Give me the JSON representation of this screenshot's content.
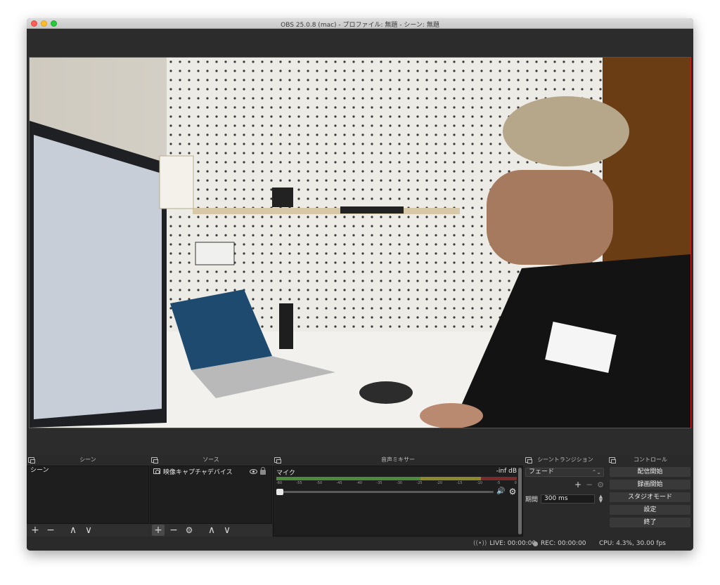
{
  "window": {
    "title": "OBS 25.0.8 (mac) - プロファイル: 無題 - シーン: 無題"
  },
  "docks": {
    "scenes": {
      "title": "シーン",
      "items": [
        "シーン"
      ],
      "toolbar": [
        "+",
        "−",
        "∧",
        "∨"
      ]
    },
    "sources": {
      "title": "ソース",
      "items": [
        {
          "label": "映像キャプチャデバイス",
          "icon": "camera-icon"
        }
      ],
      "toolbar": [
        "+",
        "−",
        "⚙",
        "∧",
        "∨"
      ]
    },
    "mixer": {
      "title": "音声ミキサー",
      "channel_name": "マイク",
      "level": "-inf dB",
      "volume_fraction": 0,
      "ticks": [
        "-60",
        "-55",
        "-50",
        "-45",
        "-40",
        "-35",
        "-30",
        "-25",
        "-20",
        "-15",
        "-10",
        "-5",
        "0"
      ]
    },
    "transitions": {
      "title": "シーントランジション",
      "selected": "フェード",
      "duration_label": "期間",
      "duration_value": "300 ms"
    },
    "controls": {
      "title": "コントロール",
      "buttons": [
        "配信開始",
        "録画開始",
        "スタジオモード",
        "設定",
        "終了"
      ]
    }
  },
  "status": {
    "live": "LIVE: 00:00:00",
    "rec": "REC: 00:00:00",
    "cpu": "CPU: 4.3%, 30.00 fps"
  },
  "colors": {
    "panel_bg": "#2a2a2a",
    "list_bg": "#1e1e1e",
    "preview_border": "#d11d1d",
    "button_bg": "#393939"
  }
}
